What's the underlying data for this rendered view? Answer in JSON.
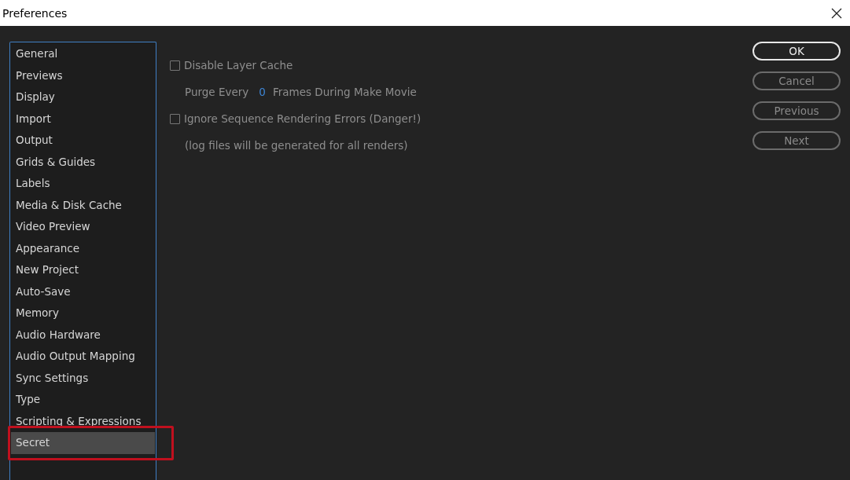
{
  "window": {
    "title": "Preferences"
  },
  "sidebar": {
    "items": [
      {
        "label": "General",
        "selected": false
      },
      {
        "label": "Previews",
        "selected": false
      },
      {
        "label": "Display",
        "selected": false
      },
      {
        "label": "Import",
        "selected": false
      },
      {
        "label": "Output",
        "selected": false
      },
      {
        "label": "Grids & Guides",
        "selected": false
      },
      {
        "label": "Labels",
        "selected": false
      },
      {
        "label": "Media & Disk Cache",
        "selected": false
      },
      {
        "label": "Video Preview",
        "selected": false
      },
      {
        "label": "Appearance",
        "selected": false
      },
      {
        "label": "New Project",
        "selected": false
      },
      {
        "label": "Auto-Save",
        "selected": false
      },
      {
        "label": "Memory",
        "selected": false
      },
      {
        "label": "Audio Hardware",
        "selected": false
      },
      {
        "label": "Audio Output Mapping",
        "selected": false
      },
      {
        "label": "Sync Settings",
        "selected": false
      },
      {
        "label": "Type",
        "selected": false
      },
      {
        "label": "Scripting & Expressions",
        "selected": false
      },
      {
        "label": "Secret",
        "selected": true
      }
    ]
  },
  "options": [
    {
      "kind": "checkbox",
      "label": "Disable Layer Cache",
      "checked": false
    },
    {
      "kind": "number",
      "label": "Purge Every",
      "value": "0",
      "suffix": "Frames During Make Movie"
    },
    {
      "kind": "checkbox",
      "label": "Ignore Sequence Rendering Errors (Danger!)",
      "checked": false
    },
    {
      "kind": "note",
      "label": "(log files will be generated for all renders)"
    }
  ],
  "buttons": [
    {
      "label": "OK",
      "disabled": false
    },
    {
      "label": "Cancel",
      "disabled": true
    },
    {
      "label": "Previous",
      "disabled": true
    },
    {
      "label": "Next",
      "disabled": true
    }
  ]
}
